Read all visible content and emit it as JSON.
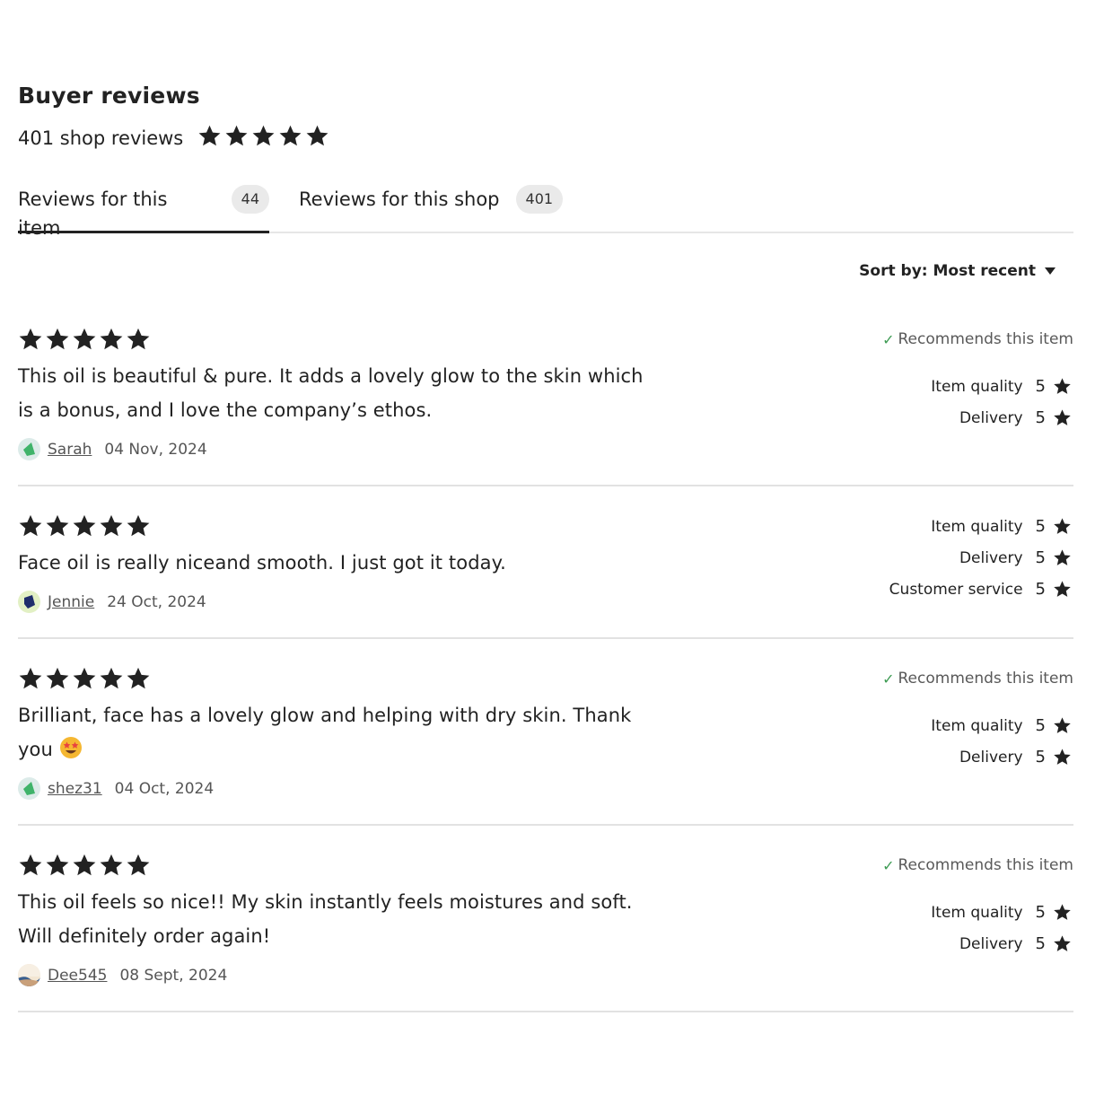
{
  "header": {
    "title": "Buyer reviews",
    "summary_text": "401 shop reviews",
    "summary_rating": 5
  },
  "tabs": [
    {
      "label": "Reviews for this item",
      "count": "44",
      "active": true
    },
    {
      "label": "Reviews for this shop",
      "count": "401",
      "active": false
    }
  ],
  "sort": {
    "label": "Sort by: Most recent"
  },
  "reviews": [
    {
      "rating": 5,
      "text": "This oil is beautiful & pure. It adds a lovely glow to the skin which is a bonus, and I love the company’s ethos.",
      "user": "Sarah",
      "date": "04 Nov, 2024",
      "recommends": "Recommends this item",
      "ratings": [
        {
          "label": "Item quality",
          "value": "5"
        },
        {
          "label": "Delivery",
          "value": "5"
        }
      ]
    },
    {
      "rating": 5,
      "text": "Face oil is really niceand smooth. I just got it today.",
      "user": "Jennie",
      "date": "24 Oct, 2024",
      "recommends": "",
      "ratings": [
        {
          "label": "Item quality",
          "value": "5"
        },
        {
          "label": "Delivery",
          "value": "5"
        },
        {
          "label": "Customer service",
          "value": "5"
        }
      ]
    },
    {
      "rating": 5,
      "text": "Brilliant, face has a lovely glow and helping with dry skin. Thank you",
      "user": "shez31",
      "date": "04 Oct, 2024",
      "recommends": "Recommends this item",
      "ratings": [
        {
          "label": "Item quality",
          "value": "5"
        },
        {
          "label": "Delivery",
          "value": "5"
        }
      ]
    },
    {
      "rating": 5,
      "text": "This oil feels so nice!! My skin instantly feels moistures and soft. Will definitely order again!",
      "user": "Dee545",
      "date": "08 Sept, 2024",
      "recommends": "Recommends this item",
      "ratings": [
        {
          "label": "Item quality",
          "value": "5"
        },
        {
          "label": "Delivery",
          "value": "5"
        }
      ]
    }
  ],
  "colors": {
    "text": "#222222",
    "muted": "#595959",
    "check": "#3d9b53",
    "divider": "#e2e2e2",
    "badge_bg": "#eaeaea"
  },
  "icons": {
    "star": "star-icon",
    "check": "check-icon",
    "caret": "caret-down-icon",
    "emoji": "star-struck-emoji-icon"
  }
}
